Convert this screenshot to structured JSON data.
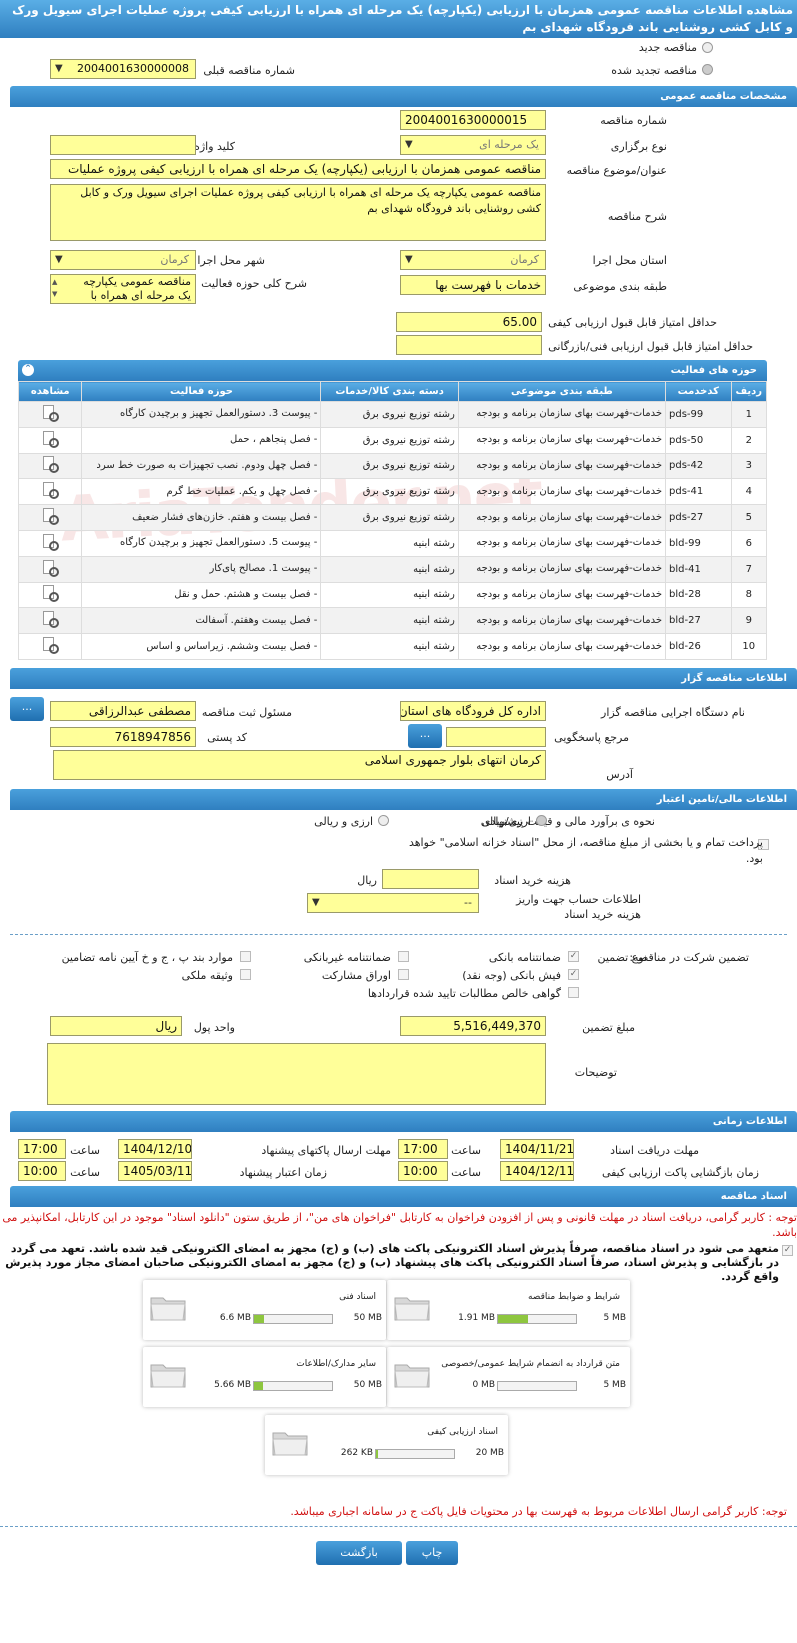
{
  "page_title": "مشاهده اطلاعات مناقصه عمومی همزمان با ارزیابی (یکپارچه) یک مرحله ای همراه با ارزیابی کیفی پروژه عملیات اجرای سیویل ورک و کابل کشی روشنایی باند فرودگاه شهدای بم",
  "top": {
    "new_label": "مناقصه جدید",
    "renewed_label": "مناقصه تجدید شده",
    "prev_number_label": "شماره مناقصه قبلی",
    "prev_number_value": "2004001630000008"
  },
  "general": {
    "header": "مشخصات مناقصه عمومی",
    "number_label": "شماره مناقصه",
    "number_value": "2004001630000015",
    "type_label": "نوع برگزاری",
    "type_value": "یک مرحله ای",
    "keyword_label": "کلید واژه",
    "keyword_value": "",
    "subject_label": "عنوان/موضوع مناقصه",
    "subject_value": "مناقصه عمومی همزمان با ارزیابی (یکپارچه) یک مرحله ای  همراه با ارزیابی کیفی پروژه عملیات",
    "desc_label": "شرح مناقصه",
    "desc_value": "مناقصه عمومی یکپارچه یک مرحله ای همراه با ارزیابی کیفی پروژه عملیات اجرای سیویل ورک و کابل کشی روشنایی باند  فرودگاه شهدای بم",
    "province_label": "استان محل اجرا",
    "province_value": "کرمان",
    "city_label": "شهر محل اجرا",
    "city_value": "کرمان",
    "category_label": "طبقه بندی موضوعی",
    "category_value": "خدمات با فهرست بها",
    "activity_desc_label": "شرح کلی حوزه فعالیت",
    "activity_desc_value": "مناقصه عمومی یکپارچه یک مرحله ای همراه با",
    "min_quality_label": "حداقل امتیاز قابل قبول ارزیابی کیفی",
    "min_quality_value": "65.00",
    "min_tech_label": "حداقل امتیاز قابل قبول ارزیابی فنی/بازرگانی",
    "min_tech_value": ""
  },
  "activity": {
    "header": "حوزه های فعالیت",
    "columns": [
      "ردیف",
      "کدخدمت",
      "طبقه بندی موضوعی",
      "دسته بندی کالا/خدمات",
      "حوزه فعالیت",
      "مشاهده"
    ],
    "rows": [
      {
        "n": "1",
        "code": "pds-99",
        "cat": "خدمات-فهرست بهای سازمان برنامه و بودجه",
        "group": "رشته توزیع نیروی برق",
        "field": "- پیوست 3. دستورالعمل تجهیز و برچیدن کارگاه"
      },
      {
        "n": "2",
        "code": "pds-50",
        "cat": "خدمات-فهرست بهای سازمان برنامه و بودجه",
        "group": "رشته توزیع نیروی برق",
        "field": "- فصل پنجاهم ، حمل"
      },
      {
        "n": "3",
        "code": "pds-42",
        "cat": "خدمات-فهرست بهای سازمان برنامه و بودجه",
        "group": "رشته توزیع نیروی برق",
        "field": "- فصل چهل ودوم. نصب تجهیزات به صورت خط سرد"
      },
      {
        "n": "4",
        "code": "pds-41",
        "cat": "خدمات-فهرست بهای سازمان برنامه و بودجه",
        "group": "رشته توزیع نیروی برق",
        "field": "- فصل چهل و یکم. عملیات خط گرم"
      },
      {
        "n": "5",
        "code": "pds-27",
        "cat": "خدمات-فهرست بهای سازمان برنامه و بودجه",
        "group": "رشته توزیع نیروی برق",
        "field": "- فصل بیست و هفتم. خازن‌های فشار ضعیف"
      },
      {
        "n": "6",
        "code": "bld-99",
        "cat": "خدمات-فهرست بهای سازمان برنامه و بودجه",
        "group": "رشته ابنیه",
        "field": "- پیوست 5. دستورالعمل تجهیز و برچیدن کارگاه"
      },
      {
        "n": "7",
        "code": "bld-41",
        "cat": "خدمات-فهرست بهای سازمان برنامه و بودجه",
        "group": "رشته ابنیه",
        "field": "- پیوست 1. مصالح پای‌کار"
      },
      {
        "n": "8",
        "code": "bld-28",
        "cat": "خدمات-فهرست بهای سازمان برنامه و بودجه",
        "group": "رشته ابنیه",
        "field": "- فصل بیست و هشتم. حمل و نقل"
      },
      {
        "n": "9",
        "code": "bld-27",
        "cat": "خدمات-فهرست بهای سازمان برنامه و بودجه",
        "group": "رشته ابنیه",
        "field": "- فصل بیست وهفتم. آسفالت"
      },
      {
        "n": "10",
        "code": "bld-26",
        "cat": "خدمات-فهرست بهای سازمان برنامه و بودجه",
        "group": "رشته ابنیه",
        "field": "- فصل بیست وششم. زیراساس و اساس"
      }
    ]
  },
  "organizer": {
    "header": "اطلاعات مناقصه گزار",
    "org_label": "نام دستگاه اجرایی مناقصه گزار",
    "org_value": "اداره کل فرودگاه های استان",
    "responsible_label": "مسئول ثبت مناقصه",
    "responsible_value": "مصطفی عبدالرزاقی",
    "ref_label": "مرجع پاسخگویی",
    "ref_value": "",
    "postal_label": "کد پستی",
    "postal_value": "7618947856",
    "address_label": "آدرس",
    "address_value": "کرمان انتهای بلوار جمهوری اسلامی",
    "dots": "..."
  },
  "finance": {
    "header": "اطلاعات مالی/تامین اعتبار",
    "estimate_label": "نحوه ی برآورد مالی و قیمت پیشنهادی",
    "opt_rial": "ارزی/ریالی",
    "opt_both": "ارزی و ریالی",
    "treasury_text": "پرداخت تمام و یا بخشی از مبلغ مناقصه، از محل \"اسناد خزانه اسلامی\" خواهد بود.",
    "doc_cost_label": "هزینه خرید اسناد",
    "doc_cost_value": "",
    "doc_cost_unit": "ریال",
    "account_label": "اطلاعات حساب جهت واریز هزینه خرید اسناد",
    "account_value": "--"
  },
  "guarantee": {
    "title_label": "تضمین شرکت در مناقصه:",
    "type_label": "نوع تضمین",
    "opts": [
      "ضمانتنامه بانکی",
      "ضمانتنامه غیربانکی",
      "موارد بند پ ، ج و خ آیین نامه تضامین",
      "فیش بانکی (وجه نقد)",
      "اوراق مشارکت",
      "وثیقه ملکی",
      "گواهی خالص مطالبات تایید شده قراردادها"
    ],
    "amount_label": "مبلغ تضمین",
    "amount_value": "5,516,449,370",
    "currency_label": "واحد پول",
    "currency_value": "ریال",
    "notes_label": "توضیحات",
    "notes_value": ""
  },
  "timing": {
    "header": "اطلاعات زمانی",
    "doc_receive_label": "مهلت دریافت اسناد",
    "doc_receive_date": "1404/11/21",
    "doc_receive_time": "17:00",
    "send_label": "مهلت ارسال پاکتهای پیشنهاد",
    "send_date": "1404/12/10",
    "send_time": "17:00",
    "open_label": "زمان بازگشایی پاکت ارزیابی کیفی",
    "open_date": "1404/12/11",
    "open_time": "10:00",
    "valid_label": "زمان اعتبار پیشنهاد",
    "valid_date": "1405/03/11",
    "valid_time": "10:00",
    "time_label": "ساعت"
  },
  "docs": {
    "header": "اسناد مناقصه",
    "notice": "توجه : کاربر گرامی، دریافت اسناد در مهلت قانونی و پس از افزودن فراخوان به کارتابل \"فراخوان های من\"، از طریق ستون \"دانلود اسناد\" موجود در این کارتابل، امکانپذیر می باشد.",
    "commit": "متعهد می شود در اسناد مناقصه، صرفاً پذیرش اسناد الکترونیکی پاکت های (ب) و (ج) مجهز به امضای الکترونیکی قید شده باشد. تعهد می گردد در بازگشایی و پذیرش اسناد، صرفاً اسناد الکترونیکی پاکت های پیشنهاد (ب) و (ج) مجهز به امضای الکترونیکی صاحبان امضای مجاز مورد پذیرش واقع گردد.",
    "cards": [
      {
        "title": "شرایط و ضوابط مناقصه",
        "max": "5 MB",
        "cur": "1.91 MB",
        "fill": 0.38
      },
      {
        "title": "اسناد فنی",
        "max": "50 MB",
        "cur": "6.6 MB",
        "fill": 0.13
      },
      {
        "title": "متن قرارداد به انضمام شرایط عمومی/خصوصی",
        "max": "5 MB",
        "cur": "0 MB",
        "fill": 0.0
      },
      {
        "title": "سایر مدارک/اطلاعات",
        "max": "50 MB",
        "cur": "5.66 MB",
        "fill": 0.11
      },
      {
        "title": "اسناد ارزیابی کیفی",
        "max": "20 MB",
        "cur": "262 KB",
        "fill": 0.02
      }
    ],
    "bottom_notice": "توجه: کاربر گرامی ارسال اطلاعات مربوط به فهرست بها در محتویات فایل پاکت ج در سامانه اجباری میباشد."
  },
  "buttons": {
    "print": "چاپ",
    "back": "بازگشت"
  },
  "watermark": "AriaTender.net"
}
